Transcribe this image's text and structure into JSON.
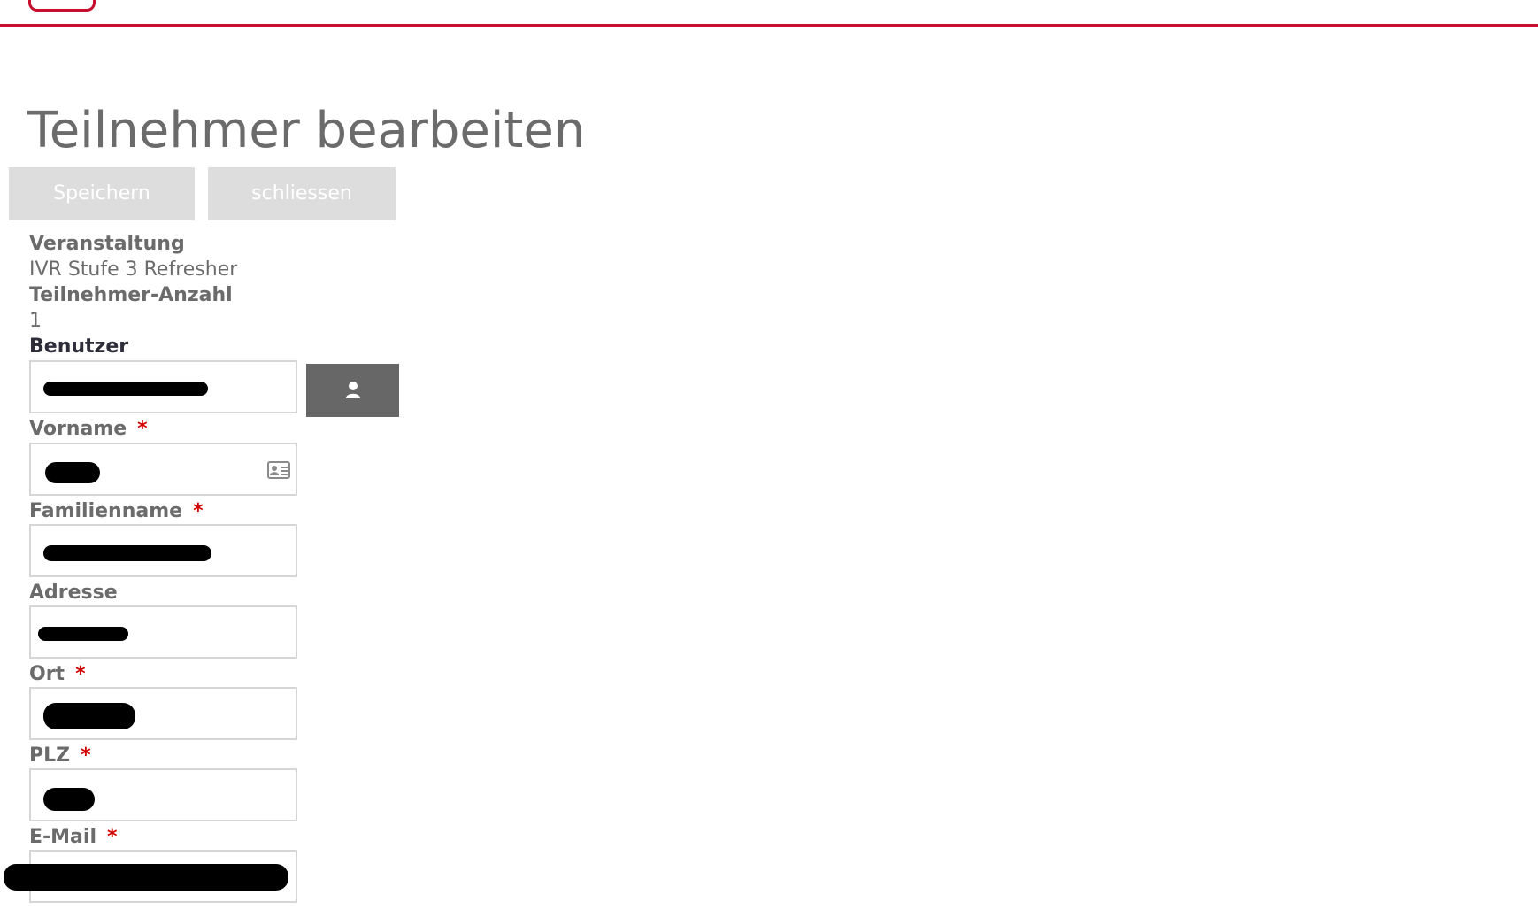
{
  "page": {
    "title": "Teilnehmer bearbeiten"
  },
  "toolbar": {
    "save_label": "Speichern",
    "close_label": "schliessen"
  },
  "form": {
    "event": {
      "label": "Veranstaltung",
      "value": "IVR Stufe 3 Refresher"
    },
    "participant_count": {
      "label": "Teilnehmer-Anzahl",
      "value": "1"
    },
    "user": {
      "label": "Benutzer",
      "value": "",
      "lookup_icon": "user-icon"
    },
    "first_name": {
      "label": "Vorname",
      "required_mark": "*",
      "value": "",
      "icon": "contact-card-icon"
    },
    "last_name": {
      "label": "Familienname",
      "required_mark": "*",
      "value": ""
    },
    "address": {
      "label": "Adresse",
      "value": ""
    },
    "city": {
      "label": "Ort",
      "required_mark": "*",
      "value": ""
    },
    "zip": {
      "label": "PLZ",
      "required_mark": "*",
      "value": ""
    },
    "email": {
      "label": "E-Mail",
      "required_mark": "*",
      "value": ""
    }
  },
  "colors": {
    "accent": "#c8102e",
    "required": "#d40000",
    "button_bg": "#dddddd",
    "user_button_bg": "#676767"
  }
}
